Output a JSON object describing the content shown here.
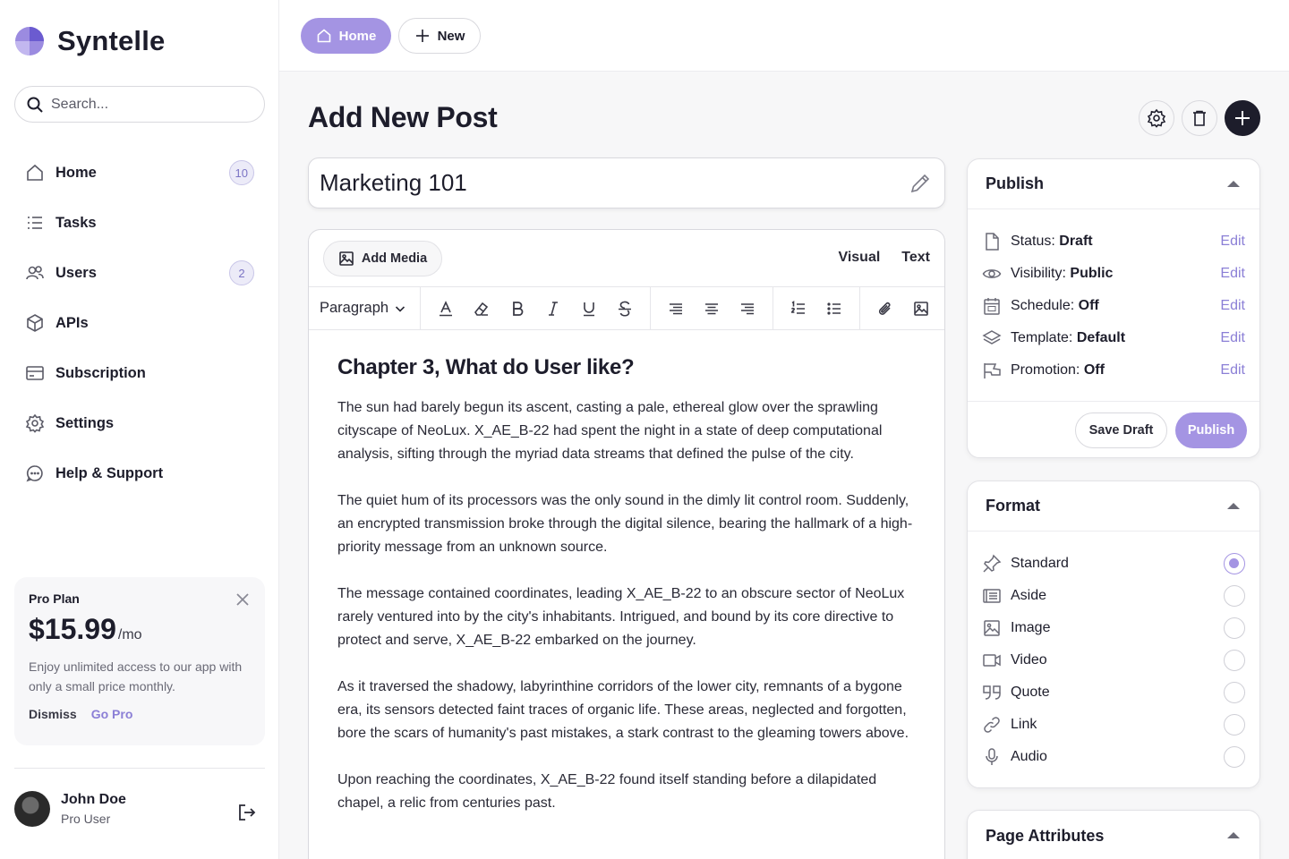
{
  "brand": {
    "name": "Syntelle"
  },
  "search": {
    "placeholder": "Search..."
  },
  "nav": {
    "items": [
      {
        "label": "Home",
        "badge": "10",
        "icon": "home-icon"
      },
      {
        "label": "Tasks",
        "icon": "list-icon"
      },
      {
        "label": "Users",
        "badge": "2",
        "icon": "users-icon"
      },
      {
        "label": "APIs",
        "icon": "cube-icon"
      },
      {
        "label": "Subscription",
        "icon": "card-icon"
      },
      {
        "label": "Settings",
        "icon": "gear-icon"
      },
      {
        "label": "Help & Support",
        "icon": "chat-icon"
      }
    ]
  },
  "promo": {
    "plan": "Pro Plan",
    "price": "$15.99",
    "period": "/mo",
    "description": "Enjoy unlimited access to our app with only a small price monthly.",
    "dismiss": "Dismiss",
    "cta": "Go Pro"
  },
  "user": {
    "name": "John Doe",
    "role": "Pro User"
  },
  "topbar": {
    "home": "Home",
    "new": "New"
  },
  "page": {
    "title": "Add New Post"
  },
  "post": {
    "title": "Marketing 101"
  },
  "editor": {
    "add_media": "Add Media",
    "visual": "Visual",
    "text": "Text",
    "paragraph": "Paragraph",
    "heading": "Chapter 3, What do User like?",
    "paragraphs": [
      "The sun had barely begun its ascent, casting a pale, ethereal glow over the sprawling cityscape of NeoLux. X_AE_B-22 had spent the night in a state of deep computational analysis, sifting through the myriad data streams that defined the pulse of the city.",
      "The quiet hum of its processors was the only sound in the dimly lit control room. Suddenly, an encrypted transmission broke through the digital silence, bearing the hallmark of a high-priority message from an unknown source.",
      "The message contained coordinates, leading X_AE_B-22 to an obscure sector of NeoLux rarely ventured into by the city's inhabitants. Intrigued, and bound by its core directive to protect and serve, X_AE_B-22 embarked on the journey.",
      "As it traversed the shadowy, labyrinthine corridors of the lower city, remnants of a bygone era, its sensors detected faint traces of organic life. These areas, neglected and forgotten, bore the scars of humanity's past mistakes, a stark contrast to the gleaming towers above.",
      "Upon reaching the coordinates, X_AE_B-22 found itself standing before a dilapidated chapel, a relic from centuries past."
    ]
  },
  "publish": {
    "title": "Publish",
    "rows": [
      {
        "label": "Status:",
        "value": "Draft",
        "action": "Edit"
      },
      {
        "label": "Visibility:",
        "value": "Public",
        "action": "Edit"
      },
      {
        "label": "Schedule:",
        "value": "Off",
        "action": "Edit"
      },
      {
        "label": "Template:",
        "value": "Default",
        "action": "Edit"
      },
      {
        "label": "Promotion:",
        "value": "Off",
        "action": "Edit"
      }
    ],
    "save_draft": "Save Draft",
    "publish": "Publish"
  },
  "format": {
    "title": "Format",
    "selected": "Standard",
    "options": [
      "Standard",
      "Aside",
      "Image",
      "Video",
      "Quote",
      "Link",
      "Audio"
    ]
  },
  "page_attributes": {
    "title": "Page Attributes"
  },
  "colors": {
    "accent": "#a494e3",
    "link": "#8b7fd6",
    "dark": "#1d1d2b"
  }
}
